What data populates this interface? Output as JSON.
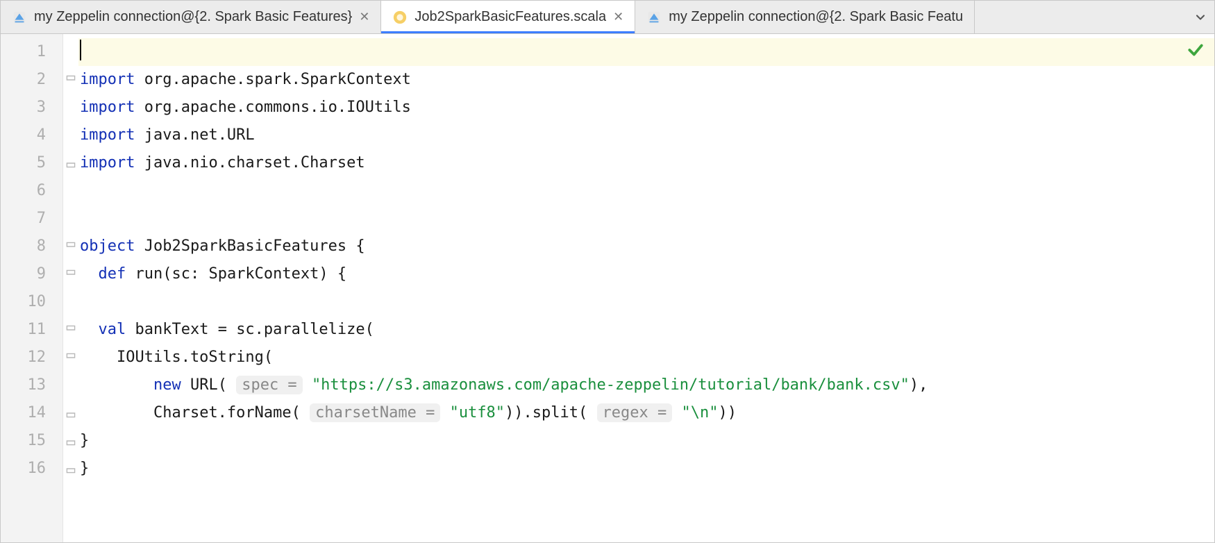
{
  "tabs": [
    {
      "label": "my Zeppelin connection@{2. Spark Basic Features}",
      "icon": "zeppelin-file-icon",
      "active": false
    },
    {
      "label": "Job2SparkBasicFeatures.scala",
      "icon": "scala-file-icon",
      "active": true
    },
    {
      "label": "my Zeppelin connection@{2. Spark Basic Featu",
      "icon": "zeppelin-file-icon",
      "active": false
    }
  ],
  "line_numbers": [
    "1",
    "2",
    "3",
    "4",
    "5",
    "6",
    "7",
    "8",
    "9",
    "10",
    "11",
    "12",
    "13",
    "14",
    "15",
    "16"
  ],
  "status": "ok",
  "code": {
    "l2": {
      "kw": "import",
      "rest": " org.apache.spark.SparkContext"
    },
    "l3": {
      "kw": "import",
      "rest": " org.apache.commons.io.IOUtils"
    },
    "l4": {
      "kw": "import",
      "rest": " java.net.URL"
    },
    "l5": {
      "kw": "import",
      "rest": " java.nio.charset.Charset"
    },
    "l8": {
      "kw": "object",
      "rest": " Job2SparkBasicFeatures {"
    },
    "l9": {
      "indent": "  ",
      "kw": "def",
      "rest": " run(sc: SparkContext) {"
    },
    "l11": {
      "indent": "  ",
      "kw": "val",
      "rest": " bankText = sc.parallelize("
    },
    "l12": {
      "text": "    IOUtils.toString("
    },
    "l13": {
      "indent": "        ",
      "kw": "new",
      "mid1": " URL( ",
      "hint1": "spec =",
      "mid2": " ",
      "str": "\"https://s3.amazonaws.com/apache-zeppelin/tutorial/bank/bank.csv\"",
      "tail": "),"
    },
    "l14": {
      "indent": "        ",
      "mid1": "Charset.forName( ",
      "hint1": "charsetName =",
      "mid2": " ",
      "str1": "\"utf8\"",
      "mid3": ")).split( ",
      "hint2": "regex =",
      "mid4": " ",
      "str2": "\"\\n\"",
      "tail": "))"
    },
    "l15": {
      "text": "}"
    },
    "l16": {
      "text": "}"
    }
  }
}
